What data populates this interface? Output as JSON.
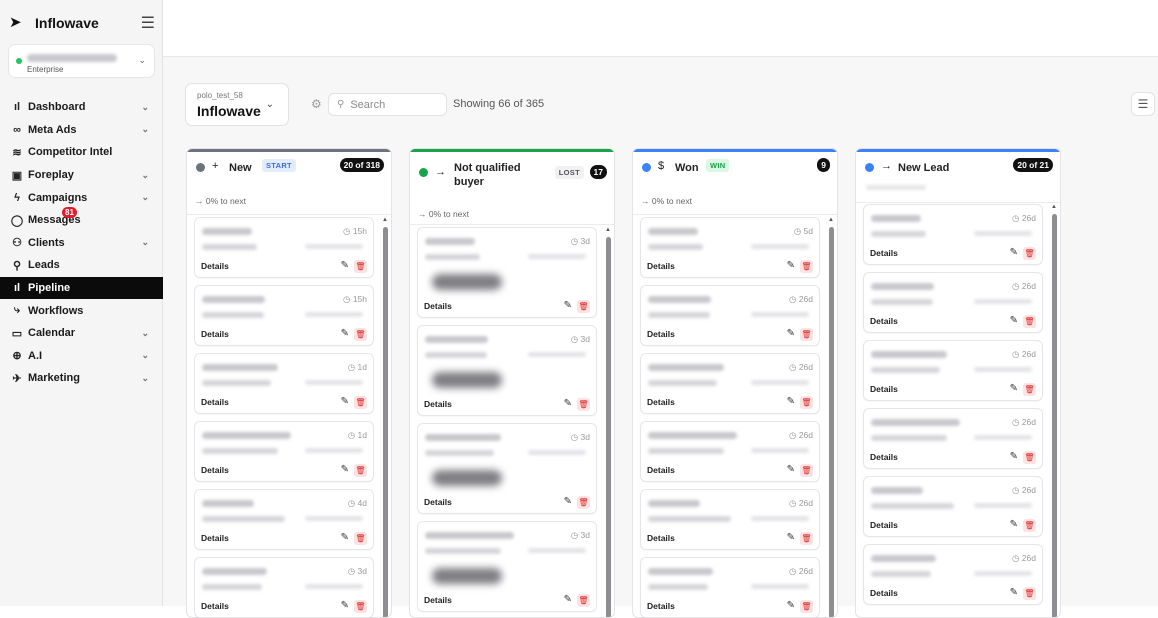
{
  "sidebar": {
    "brand": "Inflowave",
    "account_plan": "Enterprise",
    "items": [
      {
        "label": "Dashboard",
        "icon": "bar-chart-icon",
        "glyph": "ıl",
        "chevron": true
      },
      {
        "label": "Meta Ads",
        "icon": "infinity-icon",
        "glyph": "∞",
        "chevron": true
      },
      {
        "label": "Competitor Intel",
        "icon": "radar-icon",
        "glyph": "≋",
        "chevron": false
      },
      {
        "label": "Foreplay",
        "icon": "foreplay-icon",
        "glyph": "▣",
        "chevron": true
      },
      {
        "label": "Campaigns",
        "icon": "bolt-icon",
        "glyph": "ϟ",
        "chevron": true
      },
      {
        "label": "Messages",
        "icon": "message-icon",
        "glyph": "◯",
        "chevron": false,
        "badge": "81"
      },
      {
        "label": "Clients",
        "icon": "users-icon",
        "glyph": "⚇",
        "chevron": true
      },
      {
        "label": "Leads",
        "icon": "user-plus-icon",
        "glyph": "⚲",
        "chevron": false
      },
      {
        "label": "Pipeline",
        "icon": "pipeline-icon",
        "glyph": "ıl",
        "chevron": false,
        "active": true
      },
      {
        "label": "Workflows",
        "icon": "workflow-icon",
        "glyph": "⤷",
        "chevron": false
      },
      {
        "label": "Calendar",
        "icon": "calendar-icon",
        "glyph": "▭",
        "chevron": true
      },
      {
        "label": "A.I",
        "icon": "ai-icon",
        "glyph": "⊕",
        "chevron": true
      },
      {
        "label": "Marketing",
        "icon": "rocket-icon",
        "glyph": "✈",
        "chevron": true
      }
    ]
  },
  "toolbar": {
    "workspace_sub": "polo_test_58",
    "workspace_name": "Inflowave",
    "search_placeholder": "Search",
    "showing": "Showing 66 of 365"
  },
  "columns": [
    {
      "title": "New",
      "symbol": "+",
      "tag": "START",
      "tag_bg": "#e3ecfd",
      "tag_fg": "#3b6fe0",
      "count": "20 of 318",
      "color": "#6b7280",
      "next": "→ 0% to next",
      "cards": [
        {
          "time": "15h"
        },
        {
          "time": "15h"
        },
        {
          "time": "1d"
        },
        {
          "time": "1d"
        },
        {
          "time": "4d"
        },
        {
          "time": "3d"
        }
      ]
    },
    {
      "title": "Not qualified buyer",
      "symbol": "→",
      "tag": "LOST",
      "tag_bg": "#f1f1f3",
      "tag_fg": "#555",
      "count": "17",
      "color": "#16a34a",
      "next": "→ 0% to next",
      "cards": [
        {
          "time": "3d"
        },
        {
          "time": "3d"
        },
        {
          "time": "3d"
        },
        {
          "time": "3d"
        }
      ]
    },
    {
      "title": "Won",
      "symbol": "$",
      "tag": "WIN",
      "tag_bg": "#dcf7e3",
      "tag_fg": "#16a34a",
      "count": "9",
      "color": "#3b82f6",
      "next": "→ 0% to next",
      "cards": [
        {
          "time": "5d"
        },
        {
          "time": "26d"
        },
        {
          "time": "26d"
        },
        {
          "time": "26d"
        },
        {
          "time": "26d"
        },
        {
          "time": "26d"
        }
      ]
    },
    {
      "title": "New Lead",
      "symbol": "→",
      "tag": "",
      "count": "20 of 21",
      "color": "#3b82f6",
      "next": "",
      "cards": [
        {
          "time": "26d"
        },
        {
          "time": "26d"
        },
        {
          "time": "26d"
        },
        {
          "time": "26d"
        },
        {
          "time": "26d"
        },
        {
          "time": "26d"
        }
      ]
    }
  ],
  "card_labels": {
    "details": "Details"
  },
  "accent_color": "#0b0b0c"
}
